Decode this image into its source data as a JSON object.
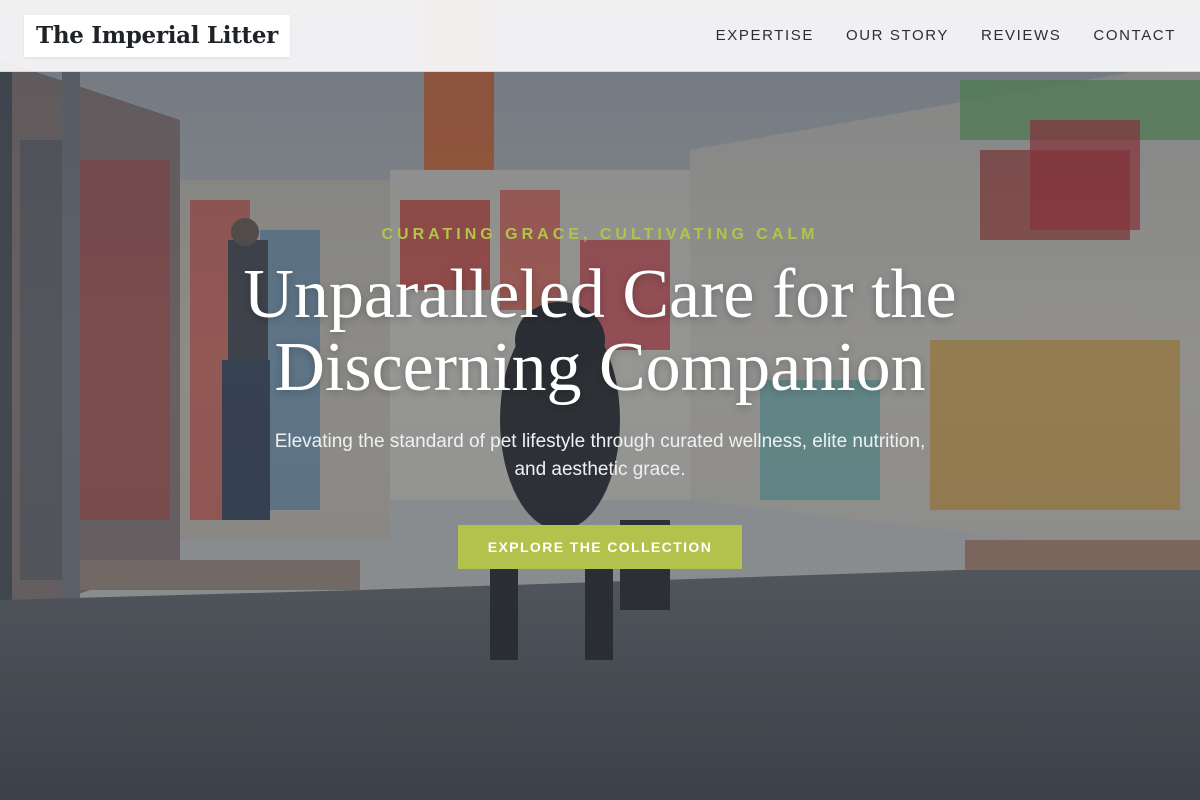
{
  "header": {
    "brand": "The Imperial Litter",
    "nav": [
      {
        "label": "EXPERTISE"
      },
      {
        "label": "OUR STORY"
      },
      {
        "label": "REVIEWS"
      },
      {
        "label": "CONTACT"
      }
    ]
  },
  "hero": {
    "eyebrow": "CURATING GRACE, CULTIVATING CALM",
    "headline": "Unparalleled Care for the Discerning Companion",
    "subtitle": "Elevating the standard of pet lifestyle through curated wellness, elite nutrition, and aesthetic grace.",
    "cta_label": "EXPLORE THE COLLECTION"
  },
  "colors": {
    "accent": "#b4c34a",
    "nav_background": "#f8f8f9",
    "text_dark": "#2b2f35"
  }
}
